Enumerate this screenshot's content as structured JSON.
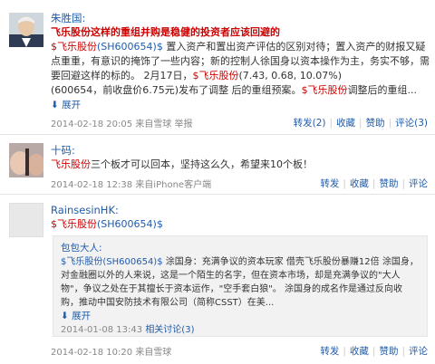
{
  "posts": [
    {
      "author": "朱胜国:",
      "title": "飞乐股份这样的重组并购是稳健的投资者应该回避的",
      "body_prefix": "$",
      "body_stock": "飞乐股份",
      "body_code": "(SH600654)$",
      "body_text1": " 置入资产和置出资产评估的区别对待；置入资产的财报又疑点重重，有意识的掩饰了一些内容；新的控制人徐国身以资本操作为主，务实不够，需要回避这样的标的。 2月17日，",
      "body_stock2": "$飞乐股份",
      "body_text2": "(7.43, 0.68, 10.07%)",
      "body_text3": "(600654，前收盘价6.75元)发布了调整 后的重组预案。",
      "body_stock3": "$飞乐股份",
      "body_text4": "调整后的重组...",
      "expand": "展开",
      "time": "2014-02-18 20:05",
      "source": "来自雪球",
      "report": "举报",
      "actions": [
        "转发(2)",
        "收藏",
        "赞助",
        "评论(3)"
      ]
    },
    {
      "author": "十码:",
      "body_stock": "飞乐股份",
      "body_text": "三个板才可以回本，坚持这么久，希望来10个板！",
      "time": "2014-02-18 12:38",
      "source": "来自iPhone客户端",
      "actions": [
        "转发",
        "收藏",
        "赞助",
        "评论"
      ]
    },
    {
      "author": "RainsesinHK:",
      "body_prefix": "$",
      "body_stock": "飞乐股份",
      "body_code": "(SH600654)$",
      "quote": {
        "author": "包包大人:",
        "line_prefix": "$飞乐股份(SH600654)$",
        "text": " 涂国身：充满争议的资本玩家 借壳飞乐股份暴赚12倍 涂国身，对金融圈以外的人来说，这是一个陌生的名字，但在资本市场，却是充满争议的\"大人物\"，争议之处在于其擅长于资本运作，\"空手套白狼\"。 涂国身的成名作是通过反向收购，推动中国安防技术有限公司（简称CSST）在美...",
        "expand": "展开",
        "time": "2014-01-08 13:43",
        "related": "相关讨论(3)"
      },
      "time": "2014-02-18 10:20",
      "source": "来自雪球",
      "actions": [
        "转发",
        "收藏",
        "赞助",
        "评论"
      ]
    }
  ]
}
